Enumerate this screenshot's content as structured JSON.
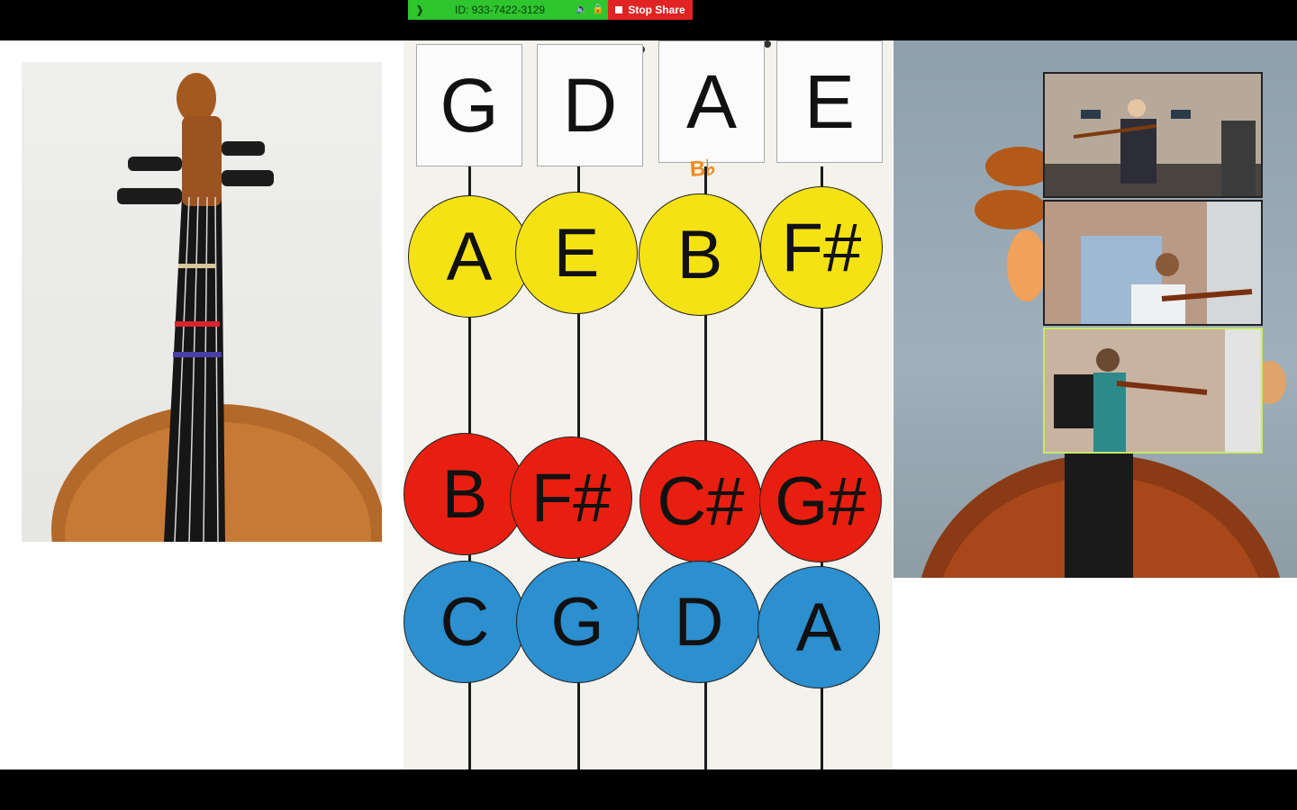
{
  "share_toolbar": {
    "meeting_id": "ID: 933-7422-3129",
    "stop_label": "Stop Share",
    "green_color": "#2ec52e",
    "red_color": "#e02424"
  },
  "string_chart": {
    "open_strings": [
      "G",
      "D",
      "A",
      "E"
    ],
    "annotation": "B♭",
    "rows": [
      {
        "color": "yellow",
        "notes": [
          "A",
          "E",
          "B",
          "F#"
        ]
      },
      {
        "color": "red",
        "notes": [
          "B",
          "F#",
          "C#",
          "G#"
        ]
      },
      {
        "color": "blue",
        "notes": [
          "C",
          "G",
          "D",
          "A"
        ]
      }
    ]
  },
  "gallery": {
    "participants": [
      "participant-video-1",
      "participant-video-2",
      "participant-video-3"
    ],
    "active_index": 2,
    "active_color": "#c9e86a"
  }
}
